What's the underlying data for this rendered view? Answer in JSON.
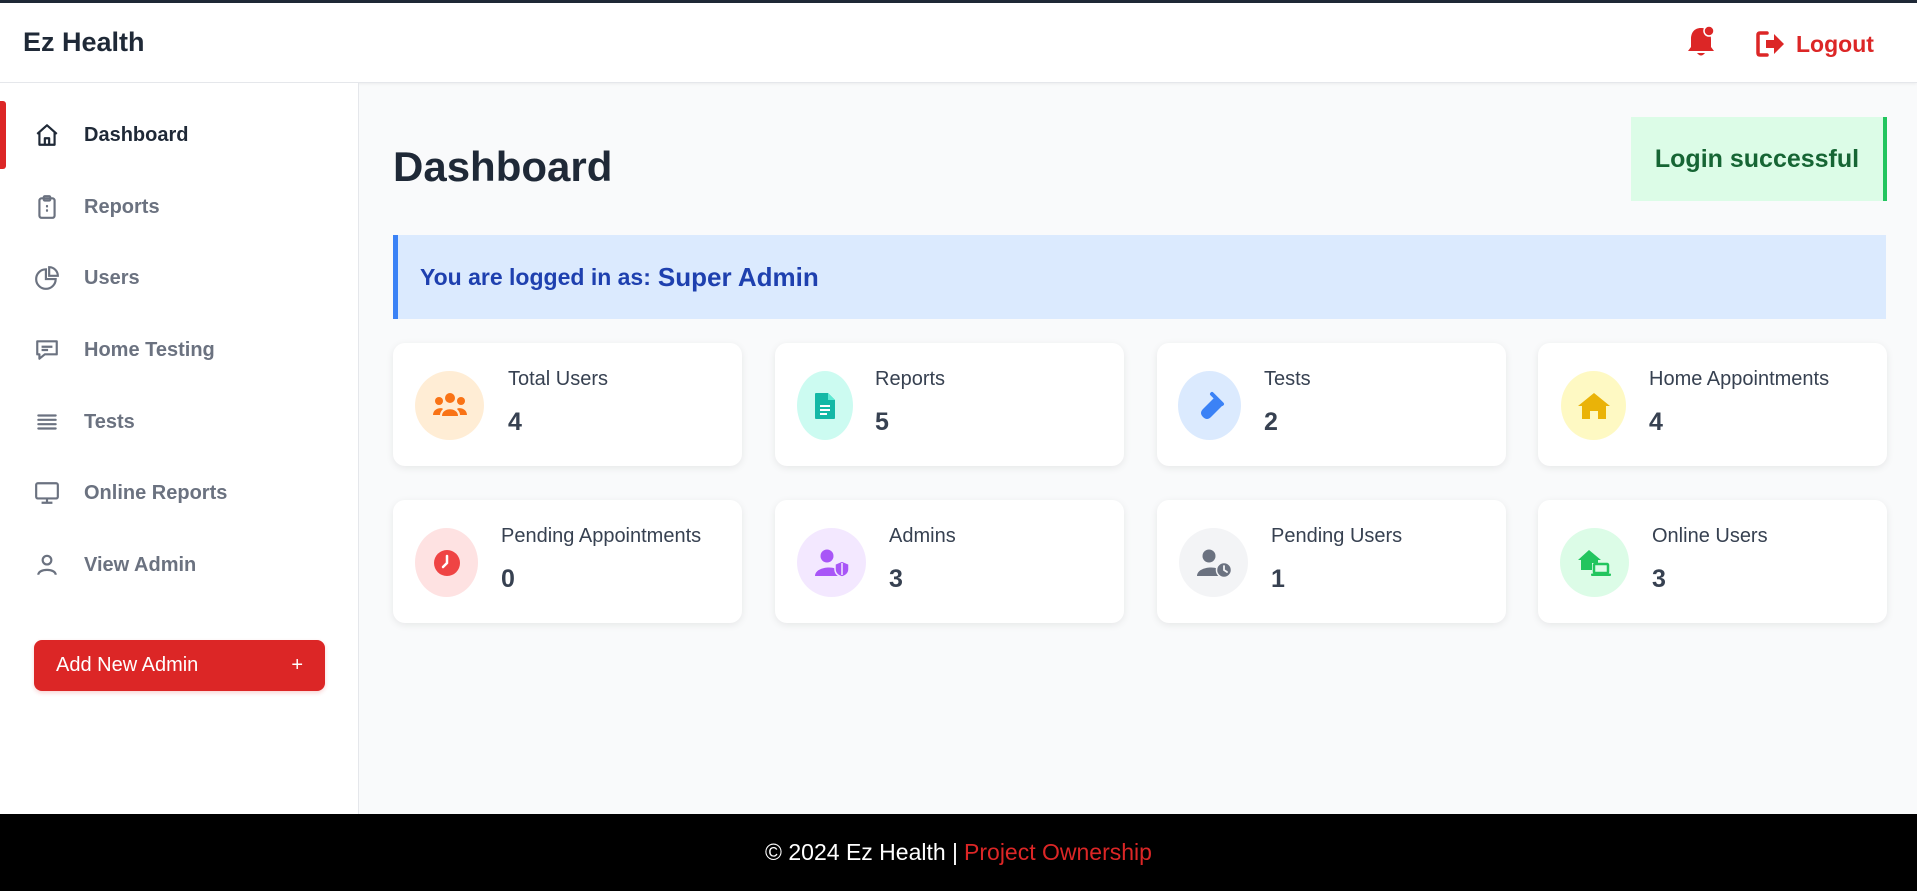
{
  "app": {
    "brand": "Ez Health"
  },
  "header": {
    "logout_label": "Logout",
    "bell_icon": "bell-icon",
    "logout_icon": "sign-out-icon"
  },
  "sidebar": {
    "items": [
      {
        "label": "Dashboard",
        "icon": "home-icon",
        "active": true
      },
      {
        "label": "Reports",
        "icon": "clipboard-icon"
      },
      {
        "label": "Users",
        "icon": "pie-chart-icon"
      },
      {
        "label": "Home Testing",
        "icon": "chat-icon"
      },
      {
        "label": "Tests",
        "icon": "list-icon"
      },
      {
        "label": "Online Reports",
        "icon": "monitor-icon"
      },
      {
        "label": "View Admin",
        "icon": "user-icon"
      }
    ],
    "add_button": {
      "label": "Add New Admin",
      "plus": "+"
    }
  },
  "main": {
    "title": "Dashboard",
    "toast": "Login successful",
    "logged_in": {
      "prefix": "You are logged in as:",
      "role": "Super Admin"
    },
    "cards": [
      {
        "label": "Total Users",
        "value": "4",
        "icon": "users-icon",
        "color": "#f97316",
        "bg": "#ffedd5"
      },
      {
        "label": "Reports",
        "value": "5",
        "icon": "file-icon",
        "color": "#14b8a6",
        "bg": "#ccfbf1"
      },
      {
        "label": "Tests",
        "value": "2",
        "icon": "test-tube-icon",
        "color": "#3b82f6",
        "bg": "#dbeafe"
      },
      {
        "label": "Home Appointments",
        "value": "4",
        "icon": "house-icon",
        "color": "#eab308",
        "bg": "#fef9c3"
      },
      {
        "label": "Pending Appointments",
        "value": "0",
        "icon": "clock-icon",
        "color": "#ef4444",
        "bg": "#fee2e2"
      },
      {
        "label": "Admins",
        "value": "3",
        "icon": "user-shield-icon",
        "color": "#a855f7",
        "bg": "#f3e8ff"
      },
      {
        "label": "Pending Users",
        "value": "1",
        "icon": "user-clock-icon",
        "color": "#6b7280",
        "bg": "#f3f4f6"
      },
      {
        "label": "Online Users",
        "value": "3",
        "icon": "house-laptop-icon",
        "color": "#22c55e",
        "bg": "#dcfce7"
      }
    ]
  },
  "footer": {
    "text": "© 2024 Ez Health |",
    "link": "Project Ownership"
  }
}
